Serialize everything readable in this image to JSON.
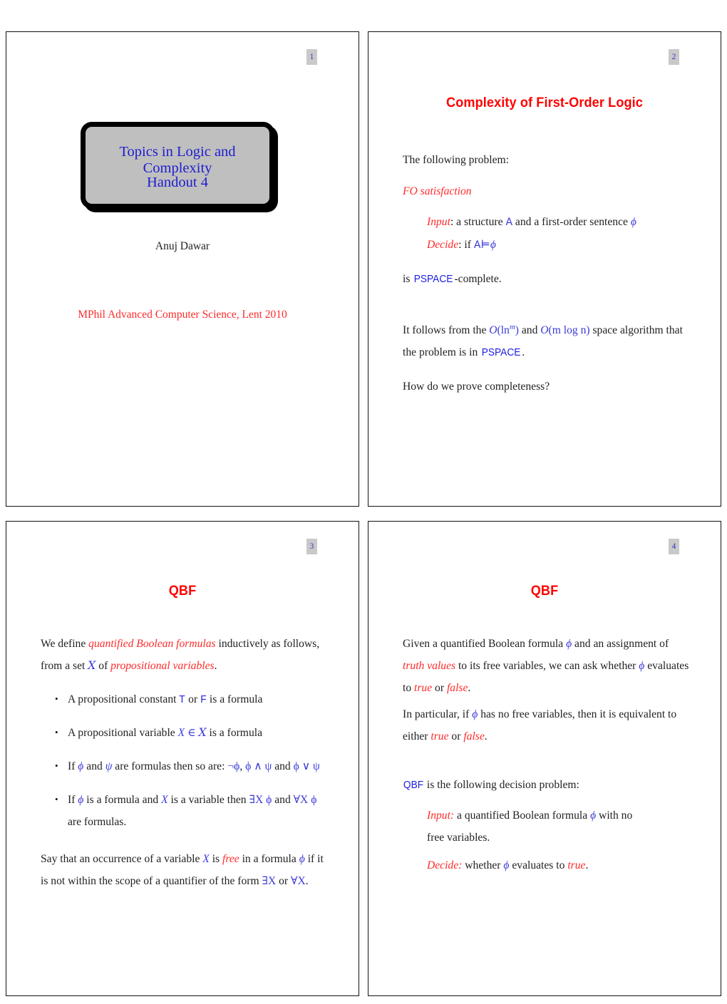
{
  "document": {
    "kind": "lecture-handout-printout",
    "slides_per_page": 4,
    "background": "#ffffff",
    "colors": {
      "heading_red": "#ff0000",
      "emphasis_red": "#ff2a2a",
      "math_blue": "#3a3ad8",
      "title_blue": "#1d1dcf",
      "badge_background": "#c9c9c9",
      "title_box_fill": "#bfbfbf",
      "frame_border": "#111111"
    }
  },
  "slides": [
    {
      "number": "1",
      "title_box": {
        "line1": "Topics in Logic and Complexity",
        "line2": "Handout 4"
      },
      "author": "Anuj Dawar",
      "course": "MPhil Advanced Computer Science, Lent 2010"
    },
    {
      "number": "2",
      "heading": "Complexity of First-Order Logic",
      "intro": "The following problem:",
      "problem_name": "FO satisfaction",
      "input_label": "Input",
      "input_text_a": ": a structure ",
      "input_symbol_structure": "A",
      "input_text_b": " and a first-order sentence ",
      "input_symbol_phi": "ϕ",
      "decide_label": "Decide",
      "decide_text_a": ": if ",
      "decide_symbol_structure": "A",
      "decide_symbol_models": "⊨",
      "decide_symbol_phi": "ϕ",
      "completeness_prefix": "is ",
      "complexity_class": "PSPACE",
      "completeness_suffix": "-complete.",
      "follows_a": "It follows from the ",
      "bound_1_fn": "O",
      "bound_1_arg": "(ln",
      "bound_1_exp": "m",
      "bound_1_close": ")",
      "follows_b": " and ",
      "bound_2_fn": "O",
      "bound_2_arg": "(m log n)",
      "follows_c": " space algorithm that the problem is in ",
      "follows_class": "PSPACE",
      "follows_d": ".",
      "question": "How do we prove completeness?"
    },
    {
      "number": "3",
      "heading": "QBF",
      "intro_a": "We define ",
      "intro_em1": "quantified Boolean formulas",
      "intro_b": " inductively as follows, from a set ",
      "intro_set": "𝑋",
      "intro_c": " of ",
      "intro_em2": "propositional variables",
      "intro_d": ".",
      "bullets": [
        {
          "a": "A propositional constant ",
          "t": "T",
          "b": " or ",
          "f": "F",
          "c": " is a formula"
        },
        {
          "a": "A propositional variable ",
          "x": "X",
          "in": "∈",
          "set": "𝑋",
          "c": " is a formula"
        },
        {
          "a": "If ",
          "phi": "ϕ",
          "b": " and ",
          "psi": "ψ",
          "c": " are formulas then so are: ",
          "neg": "¬ϕ",
          "d": ", ",
          "conj": "ϕ ∧ ψ",
          "e": " and ",
          "disj": "ϕ ∨ ψ"
        },
        {
          "a": "If ",
          "phi": "ϕ",
          "b": " is a formula and ",
          "x": "X",
          "c": " is a variable then ",
          "ex": "∃X ϕ",
          "d": " and ",
          "all": "∀X ϕ",
          "e": " are formulas."
        }
      ],
      "closing_a": "Say that an occurrence of a variable ",
      "closing_x": "X",
      "closing_b": " is ",
      "closing_free": "free",
      "closing_c": " in a formula ",
      "closing_phi": "ϕ",
      "closing_d": " if it is not within the scope of a quantifier of the form ",
      "closing_ex": "∃X",
      "closing_e": " or ",
      "closing_all": "∀X",
      "closing_f": "."
    },
    {
      "number": "4",
      "heading": "QBF",
      "p1_a": "Given a quantified Boolean formula ",
      "p1_phi": "ϕ",
      "p1_b": " and an assignment of ",
      "p1_em1": "truth values",
      "p1_c": " to its free variables, we can ask whether ",
      "p1_phi2": "ϕ",
      "p1_d": " evaluates to ",
      "p1_true": "true",
      "p1_e": " or ",
      "p1_false": "false",
      "p1_f": ".",
      "p2_a": "In particular, if ",
      "p2_phi": "ϕ",
      "p2_b": " has no free variables, then it is equivalent to either ",
      "p2_true": "true",
      "p2_c": " or ",
      "p2_false": "false",
      "p2_d": ".",
      "p3_class": "QBF",
      "p3_text": " is the following decision problem:",
      "input_label": "Input:",
      "input_a": " a quantified Boolean formula ",
      "input_phi": "ϕ",
      "input_b": " with no free variables.",
      "decide_label": "Decide:",
      "decide_a": " whether ",
      "decide_phi": "ϕ",
      "decide_b": " evaluates to ",
      "decide_true": "true",
      "decide_c": "."
    }
  ]
}
